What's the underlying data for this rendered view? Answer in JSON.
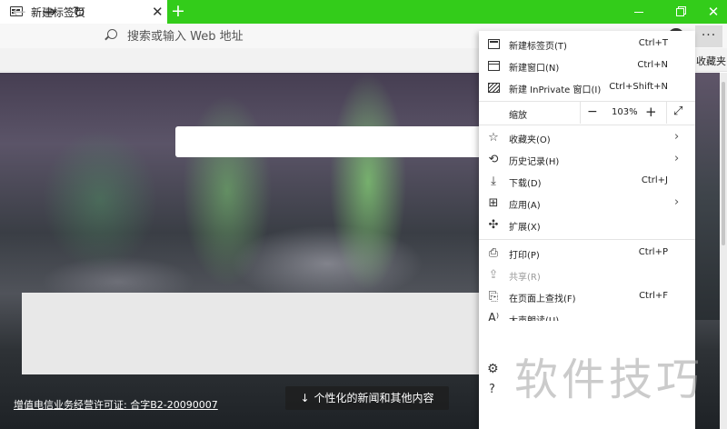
{
  "window": {
    "tab_title": "新建标签页",
    "tab_close": "✕",
    "new_tab": "+",
    "close": "✕"
  },
  "navbar": {
    "back": "←",
    "forward": "→",
    "refresh": "↻",
    "address_placeholder": "搜索或输入 Web 地址",
    "more": "···"
  },
  "favorites_bar": {
    "label": "收藏夹"
  },
  "page": {
    "license_link": "增值电信业务经营许可证: 合字B2-20090007",
    "news_button": "个性化的新闻和其他内容",
    "news_arrow": "↓"
  },
  "menu": {
    "items": [
      {
        "label": "新建标签页(T)",
        "shortcut": "Ctrl+T"
      },
      {
        "label": "新建窗口(N)",
        "shortcut": "Ctrl+N"
      },
      {
        "label": "新建 InPrivate 窗口(I)",
        "shortcut": "Ctrl+Shift+N"
      }
    ],
    "zoom": {
      "label": "缩放",
      "minus": "−",
      "value": "103%",
      "plus": "+",
      "fullscreen": "⤢"
    },
    "items2": [
      {
        "label": "收藏夹(O)",
        "chevron": "›",
        "icon": "☆"
      },
      {
        "label": "历史记录(H)",
        "chevron": "›",
        "icon": "⟲"
      },
      {
        "label": "下载(D)",
        "shortcut": "Ctrl+J",
        "icon": "⤓"
      },
      {
        "label": "应用(A)",
        "chevron": "›",
        "icon": "⊞"
      },
      {
        "label": "扩展(X)",
        "icon": "✣"
      }
    ],
    "items3": [
      {
        "label": "打印(P)",
        "shortcut": "Ctrl+P",
        "icon": "⎙"
      },
      {
        "label": "共享(R)",
        "icon": "⇪"
      },
      {
        "label": "在页面上查找(F)",
        "shortcut": "Ctrl+F",
        "icon": "⎘"
      },
      {
        "label": "大声朗读(U)",
        "icon": "A⁾"
      }
    ],
    "settings_icon": "⚙",
    "help_icon": "?"
  },
  "watermark": "软件技巧"
}
